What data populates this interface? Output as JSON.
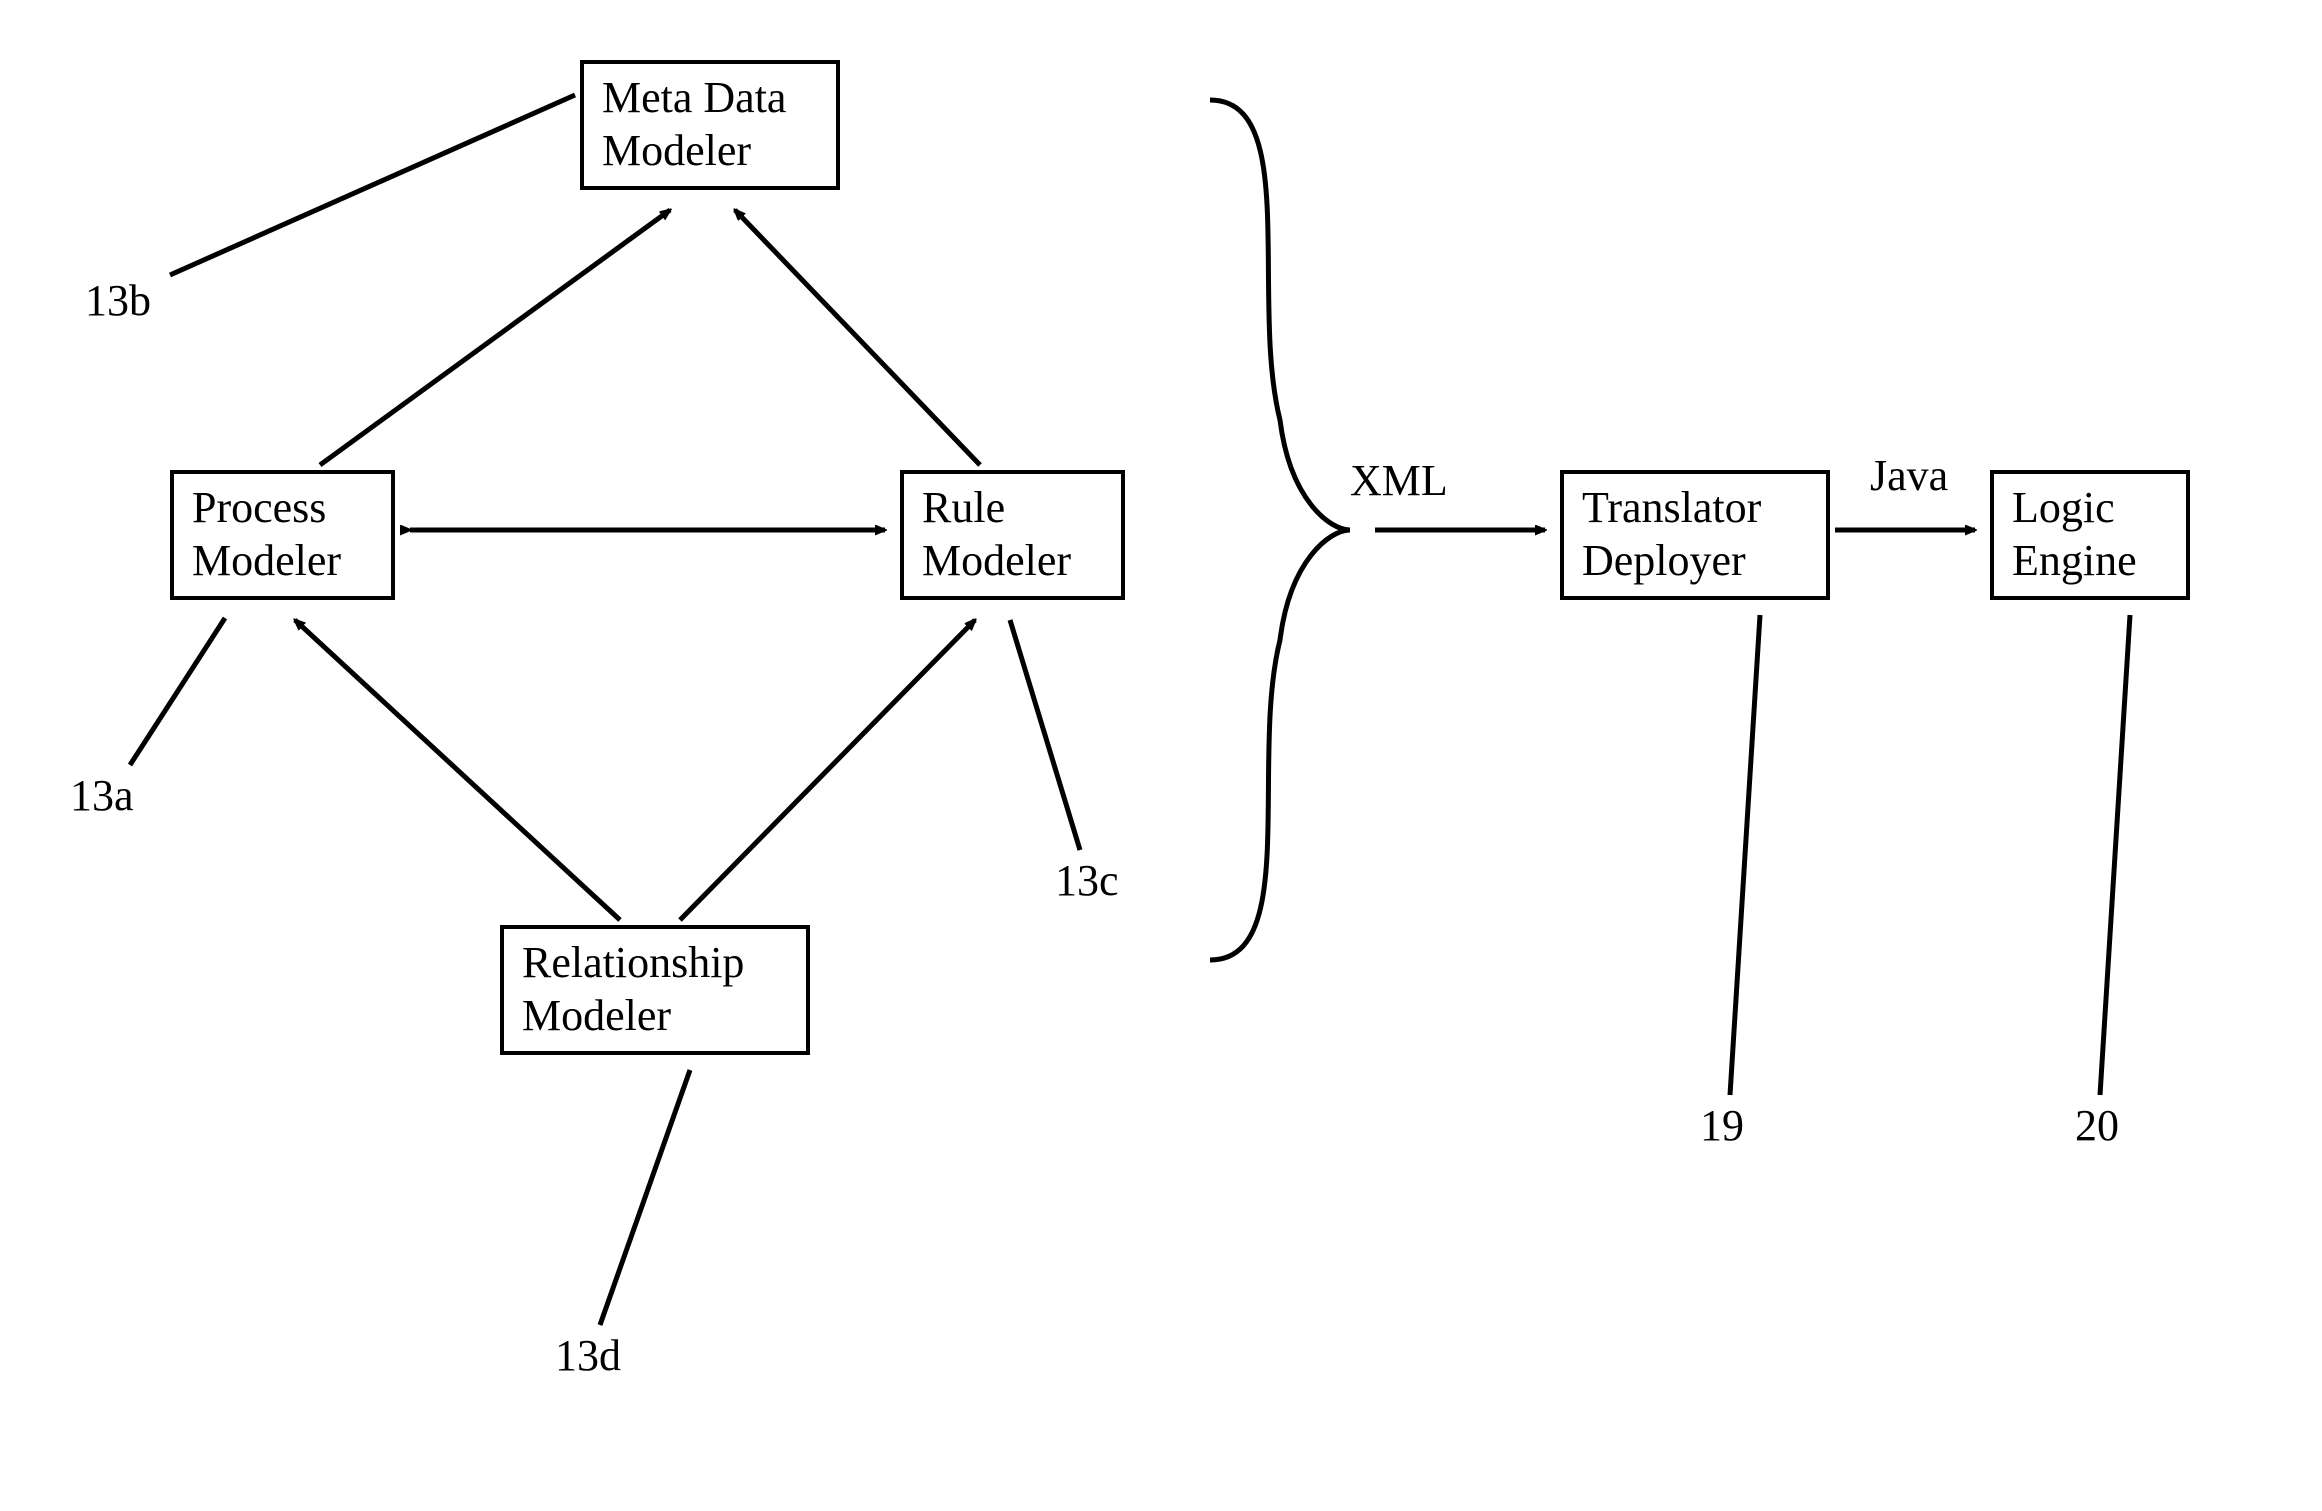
{
  "boxes": {
    "metaData": "Meta Data\nModeler",
    "process": "Process\nModeler",
    "rule": "Rule\nModeler",
    "relationship": "Relationship\nModeler",
    "translator": "Translator\nDeployer",
    "logic": "Logic\nEngine"
  },
  "labels": {
    "ref13a": "13a",
    "ref13b": "13b",
    "ref13c": "13c",
    "ref13d": "13d",
    "ref19": "19",
    "ref20": "20",
    "xml": "XML",
    "java": "Java"
  }
}
